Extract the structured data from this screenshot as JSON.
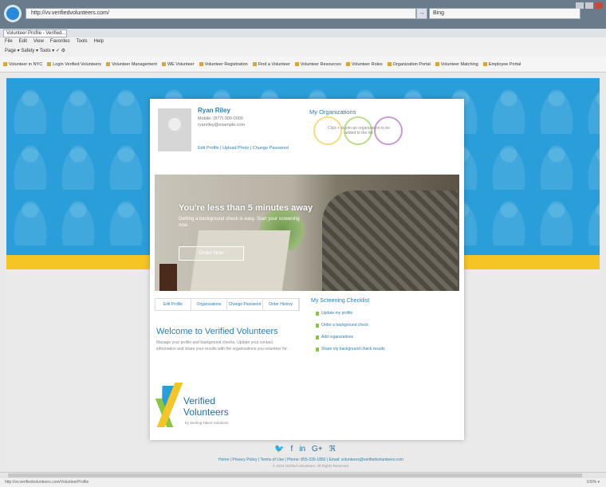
{
  "browser": {
    "address": "http://vv.verifiedvolunteers.com/",
    "go_label": "→",
    "search": "Bing",
    "tab_title": "Volunteer Profile - Verified...",
    "menu": [
      "File",
      "Edit",
      "View",
      "Favorites",
      "Tools",
      "Help"
    ],
    "command_bar": "Page ▾  Safety ▾  Tools ▾  ✓  ⚙",
    "favorites": [
      "Volunteer in NYC",
      "Login Verified Volunteers",
      "Volunteer Management",
      "WE Volunteer",
      "Volunteer Registration",
      "Find a Volunteer",
      "Volunteer Resources",
      "Volunteer Roles",
      "Organization Portal",
      "Volunteer Matching",
      "Employee Portal"
    ],
    "status_url": "http://vv.verifiedvolunteers.com/VolunteerProfile",
    "zoom": "100% ▾"
  },
  "profile": {
    "name": "Ryan Riley",
    "phone": "Mobile: (877) 000-0000",
    "email": "ryanriley@example.com",
    "links": "Edit Profile | Upload Photo | Change Password"
  },
  "organizations": {
    "title": "My Organizations",
    "empty_text": "Click + to join an organization to be added to the list"
  },
  "banner": {
    "headline": "You're less than 5 minutes away",
    "subtext": "Getting a background check is easy. Start your screening now.",
    "button": "Order Now"
  },
  "tabs": [
    "Edit Profile",
    "Organizations",
    "Change Password",
    "Order History"
  ],
  "welcome": {
    "title": "Welcome to Verified Volunteers",
    "text": "Manage your profile and background checks. Update your contact information and share your results with the organizations you volunteer for."
  },
  "screening": {
    "title": "My Screening Checklist",
    "items": [
      "Update my profile",
      "Order a background check",
      "Add organizations",
      "Share my background check results"
    ]
  },
  "logo": {
    "line1": "Verified",
    "line2": "Volunteers",
    "tagline": "by Sterling Talent Solutions"
  },
  "footer": {
    "icons": [
      "twitter-icon",
      "facebook-icon",
      "linkedin-icon",
      "google-plus-icon",
      "rss-icon"
    ],
    "links": "Home | Privacy Policy | Terms of Use | Phone: 855-326-1860 | Email: volunteers@verifiedvolunteers.com",
    "copyright": "© 2016 Verified Volunteers. All Rights Reserved."
  }
}
